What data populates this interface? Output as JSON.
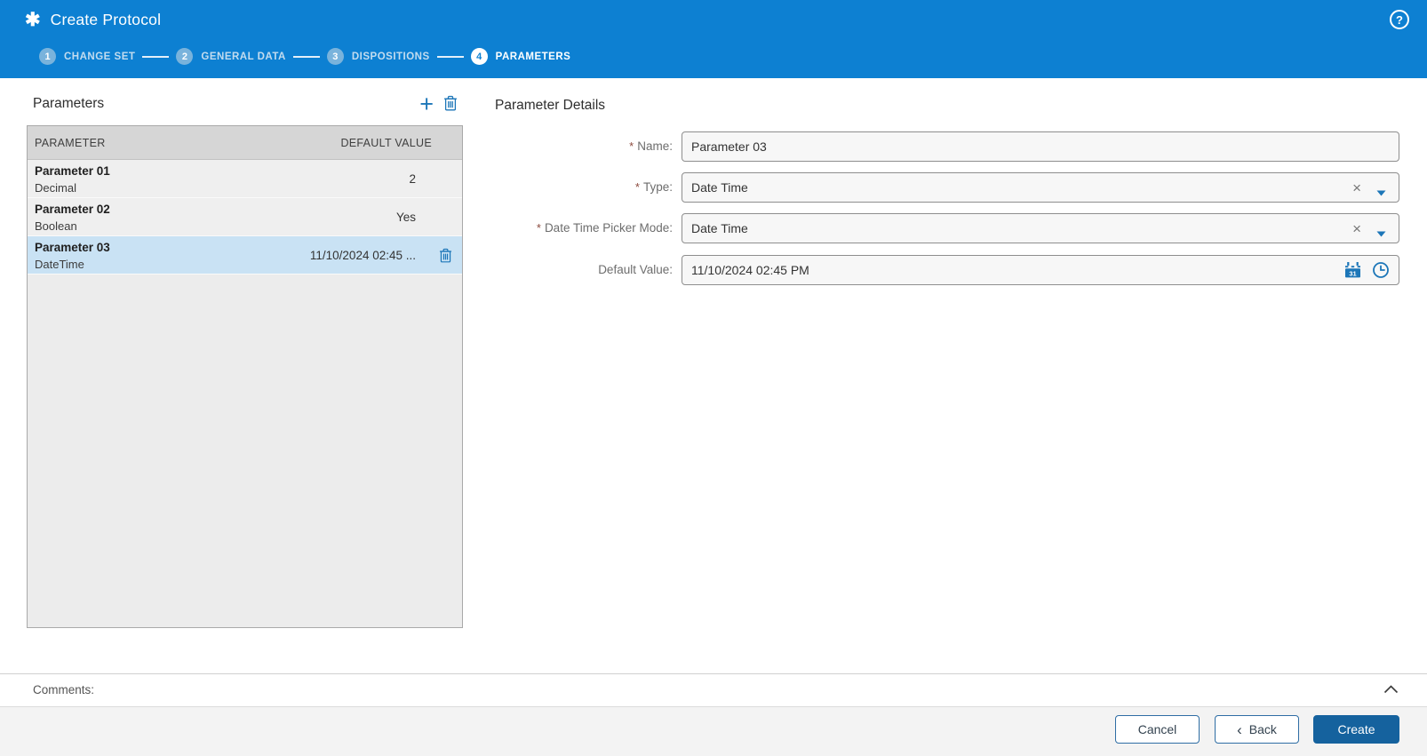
{
  "header": {
    "title": "Create Protocol",
    "steps": [
      {
        "number": "1",
        "label": "CHANGE SET"
      },
      {
        "number": "2",
        "label": "GENERAL DATA"
      },
      {
        "number": "3",
        "label": "DISPOSITIONS"
      },
      {
        "number": "4",
        "label": "PARAMETERS"
      }
    ]
  },
  "icons": {
    "app": "✱",
    "help": "?",
    "add": "+",
    "clear": "×",
    "back_chevron": "‹"
  },
  "parameters_panel": {
    "title": "Parameters",
    "columns": {
      "parameter": "PARAMETER",
      "default_value": "DEFAULT VALUE"
    },
    "rows": [
      {
        "name": "Parameter 01",
        "type": "Decimal",
        "default_value": "2"
      },
      {
        "name": "Parameter 02",
        "type": "Boolean",
        "default_value": "Yes"
      },
      {
        "name": "Parameter 03",
        "type": "DateTime",
        "default_value": "11/10/2024 02:45 ...",
        "selected": true
      }
    ]
  },
  "details_panel": {
    "title": "Parameter Details",
    "required_marker": "*",
    "fields": {
      "name": {
        "label": "Name:",
        "value": "Parameter 03"
      },
      "type": {
        "label": "Type:",
        "value": "Date Time"
      },
      "picker_mode": {
        "label": "Date Time Picker Mode:",
        "value": "Date Time"
      },
      "default_value": {
        "label": "Default Value:",
        "value": "11/10/2024 02:45 PM"
      }
    }
  },
  "comments": {
    "label": "Comments:"
  },
  "footer": {
    "cancel_label": "Cancel",
    "back_label": "Back",
    "create_label": "Create"
  },
  "colors": {
    "header_blue": "#0d80d2",
    "accent_blue": "#1c76b8",
    "selected_row": "#c9e2f4",
    "create_button": "#15629e"
  }
}
